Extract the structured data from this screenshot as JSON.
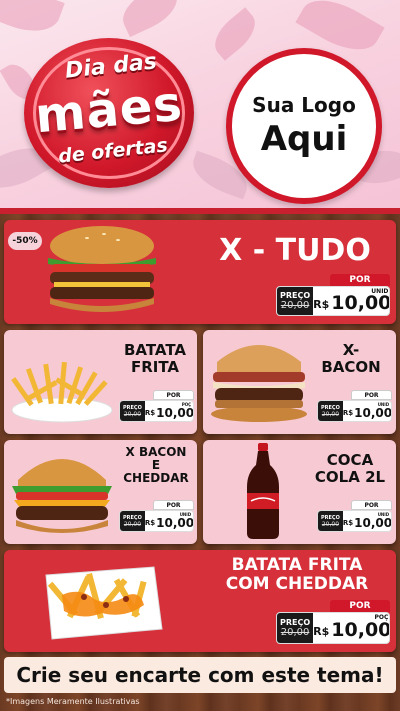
{
  "header": {
    "badge": {
      "top": "Dia das",
      "main": "mães",
      "bottom": "de ofertas"
    },
    "logo": {
      "line1": "Sua Logo",
      "line2": "Aqui"
    }
  },
  "discount_badge": "-50%",
  "products": [
    {
      "name": "X - TUDO",
      "por": "POR",
      "preco": "PREÇO",
      "old": "20,00",
      "currency": "R$",
      "price": "10,00",
      "unit": "UNID"
    },
    {
      "name_line1": "BATATA",
      "name_line2": "FRITA",
      "por": "POR",
      "preco": "PREÇO",
      "old": "20,00",
      "currency": "R$",
      "price": "10,00",
      "unit": "POÇ"
    },
    {
      "name_line1": "X-",
      "name_line2": "BACON",
      "por": "POR",
      "preco": "PREÇO",
      "old": "20,00",
      "currency": "R$",
      "price": "10,00",
      "unit": "UNID"
    },
    {
      "name_line1": "X BACON",
      "name_line2": "E",
      "name_line3": "CHEDDAR",
      "por": "POR",
      "preco": "PREÇO",
      "old": "20,00",
      "currency": "R$",
      "price": "10,00",
      "unit": "UNID"
    },
    {
      "name_line1": "COCA",
      "name_line2": "COLA 2L",
      "por": "POR",
      "preco": "PREÇO",
      "old": "20,00",
      "currency": "R$",
      "price": "10,00",
      "unit": "UNID"
    },
    {
      "name_line1": "BATATA FRITA",
      "name_line2": "COM CHEDDAR",
      "por": "POR",
      "preco": "PREÇO",
      "old": "20,00",
      "currency": "R$",
      "price": "10,00",
      "unit": "POÇ"
    }
  ],
  "cta": "Crie seu encarte com este tema!",
  "footnote": "*Imagens Meramente Ilustrativas",
  "colors": {
    "red": "#d6303a",
    "pink": "#f7c9d3",
    "wood": "#6b3a22"
  }
}
